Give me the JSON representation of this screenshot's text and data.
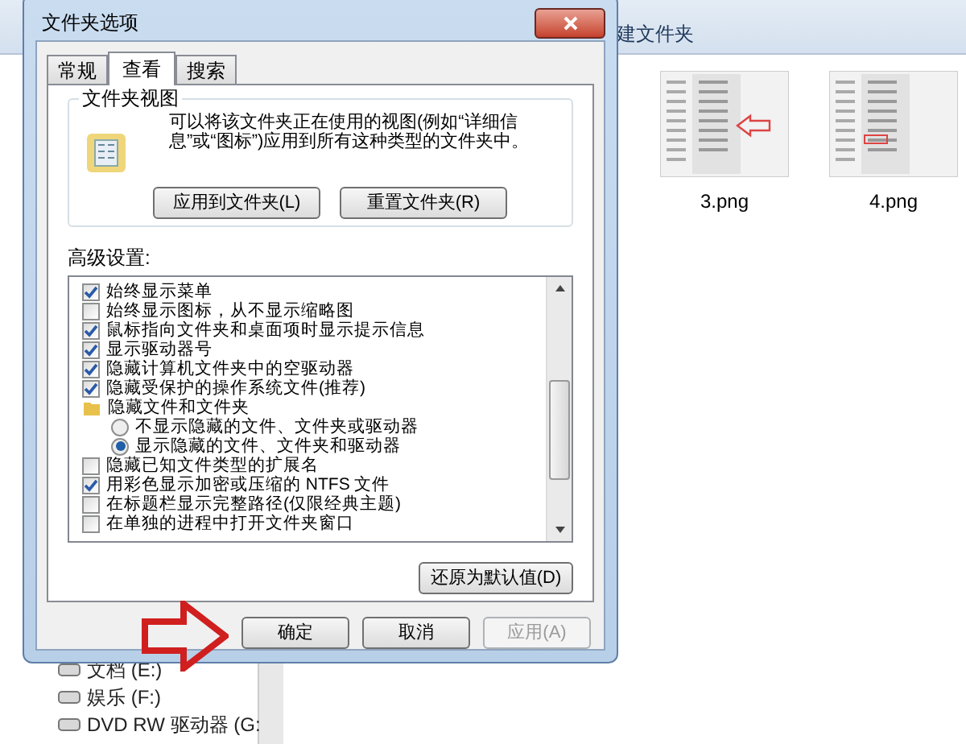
{
  "explorer": {
    "toolbar_item": "建文件夹",
    "thumbnails": [
      {
        "label": "3.png"
      },
      {
        "label": "4.png"
      }
    ],
    "drives": [
      "文档 (E:)",
      "娱乐 (F:)",
      "DVD RW 驱动器 (G:"
    ]
  },
  "dialog": {
    "title": "文件夹选项",
    "tabs": [
      {
        "label": "常规",
        "selected": false
      },
      {
        "label": "查看",
        "selected": true
      },
      {
        "label": "搜索",
        "selected": false
      }
    ],
    "folder_view": {
      "heading": "文件夹视图",
      "description": "可以将该文件夹正在使用的视图(例如“详细信息”或“图标”)应用到所有这种类型的文件夹中。",
      "buttons": [
        "应用到文件夹(L)",
        "重置文件夹(R)"
      ]
    },
    "advanced_label": "高级设置:",
    "settings": [
      {
        "kind": "checkbox",
        "label": "始终显示菜单",
        "checked": true
      },
      {
        "kind": "checkbox",
        "label": "始终显示图标，从不显示缩略图",
        "checked": false
      },
      {
        "kind": "checkbox",
        "label": "鼠标指向文件夹和桌面项时显示提示信息",
        "checked": true
      },
      {
        "kind": "checkbox",
        "label": "显示驱动器号",
        "checked": true
      },
      {
        "kind": "checkbox",
        "label": "隐藏计算机文件夹中的空驱动器",
        "checked": true
      },
      {
        "kind": "checkbox",
        "label": "隐藏受保护的操作系统文件(推荐)",
        "checked": true
      },
      {
        "kind": "folder",
        "label": "隐藏文件和文件夹",
        "children": [
          {
            "kind": "radio",
            "label": "不显示隐藏的文件、文件夹或驱动器",
            "selected": false
          },
          {
            "kind": "radio",
            "label": "显示隐藏的文件、文件夹和驱动器",
            "selected": true
          }
        ]
      },
      {
        "kind": "checkbox",
        "label": "隐藏已知文件类型的扩展名",
        "checked": false
      },
      {
        "kind": "checkbox",
        "label": "用彩色显示加密或压缩的 NTFS 文件",
        "checked": true
      },
      {
        "kind": "checkbox",
        "label": "在标题栏显示完整路径(仅限经典主题)",
        "checked": false
      },
      {
        "kind": "checkbox",
        "label": "在单独的进程中打开文件夹窗口",
        "checked": false
      }
    ],
    "restore_button": "还原为默认值(D)",
    "buttons": [
      {
        "label": "确定",
        "disabled": false
      },
      {
        "label": "取消",
        "disabled": false
      },
      {
        "label": "应用(A)",
        "disabled": true
      }
    ]
  }
}
